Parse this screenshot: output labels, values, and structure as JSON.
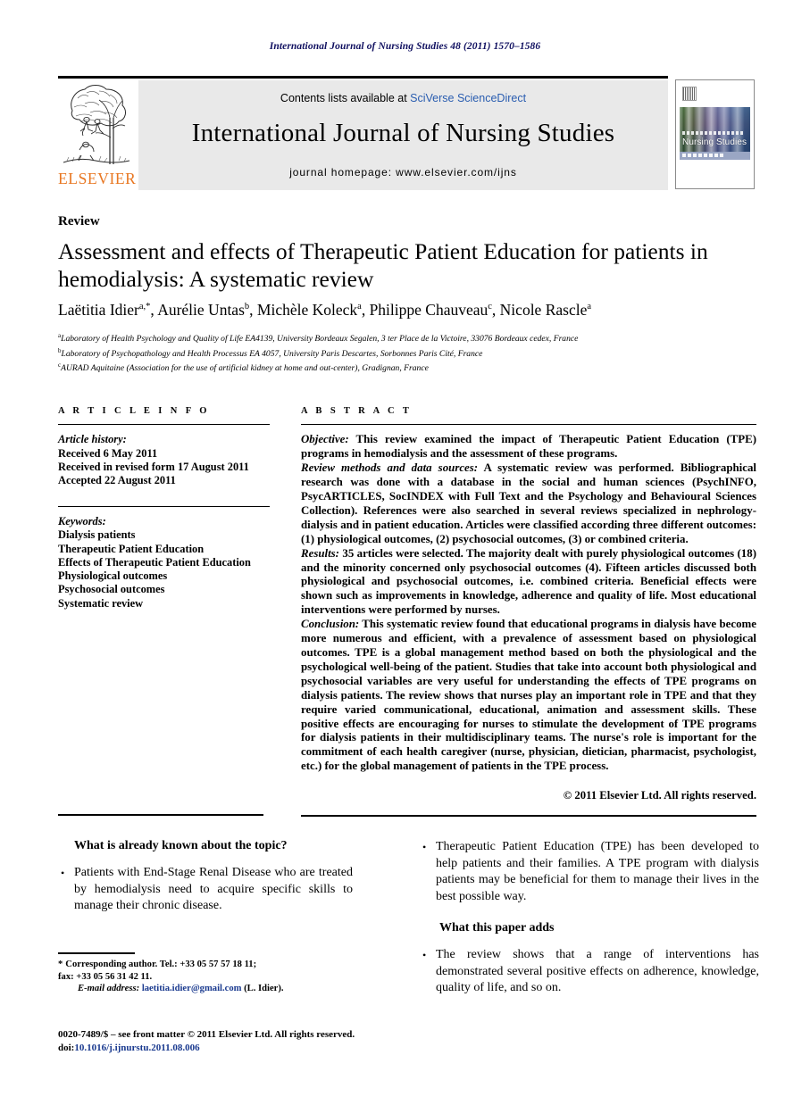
{
  "running_head": "International Journal of Nursing Studies 48 (2011) 1570–1586",
  "masthead": {
    "contents_prefix": "Contents lists available at ",
    "contents_link": "SciVerse ScienceDirect",
    "journal_name": "International Journal of Nursing Studies",
    "homepage": "journal homepage: www.elsevier.com/ijns",
    "publisher_wordmark": "ELSEVIER",
    "cover_title": "Nursing Studies",
    "accent_orange": "#E87722",
    "accent_link_blue": "#2a5db0"
  },
  "article": {
    "section": "Review",
    "title": "Assessment and effects of Therapeutic Patient Education for patients in hemodialysis: A systematic review",
    "authors": [
      {
        "name": "Laëtitia Idier",
        "marks": "a,*"
      },
      {
        "name": "Aurélie Untas",
        "marks": "b"
      },
      {
        "name": "Michèle Koleck",
        "marks": "a"
      },
      {
        "name": "Philippe Chauveau",
        "marks": "c"
      },
      {
        "name": "Nicole Rascle",
        "marks": "a"
      }
    ],
    "affiliations": [
      {
        "mark": "a",
        "text": "Laboratory of Health Psychology and Quality of Life EA4139, University Bordeaux Segalen, 3 ter Place de la Victoire, 33076 Bordeaux cedex, France"
      },
      {
        "mark": "b",
        "text": "Laboratory of Psychopathology and Health Processus EA 4057, University Paris Descartes, Sorbonnes Paris Cité, France"
      },
      {
        "mark": "c",
        "text": "AURAD Aquitaine (Association for the use of artificial kidney at home and out-center), Gradignan, France"
      }
    ]
  },
  "article_info": {
    "label": "A R T I C L E  I N F O",
    "history_title": "Article history:",
    "history": [
      "Received 6 May 2011",
      "Received in revised form 17 August 2011",
      "Accepted 22 August 2011"
    ],
    "keywords_title": "Keywords:",
    "keywords": [
      "Dialysis patients",
      "Therapeutic Patient Education",
      "Effects of Therapeutic Patient Education",
      "Physiological outcomes",
      "Psychosocial outcomes",
      "Systematic review"
    ]
  },
  "abstract": {
    "label": "A B S T R A C T",
    "sections": [
      {
        "lead": "Objective:",
        "body": " This review examined the impact of Therapeutic Patient Education (TPE) programs in hemodialysis and the assessment of these programs."
      },
      {
        "lead": "Review methods and data sources:",
        "body": " A systematic review was performed. Bibliographical research was done with a database in the social and human sciences (PsychINFO, PsycARTICLES, SocINDEX with Full Text and the Psychology and Behavioural Sciences Collection). References were also searched in several reviews specialized in nephrology-dialysis and in patient education. Articles were classified according three different outcomes: (1) physiological outcomes, (2) psychosocial outcomes, (3) or combined criteria."
      },
      {
        "lead": "Results:",
        "body": " 35 articles were selected. The majority dealt with purely physiological outcomes (18) and the minority concerned only psychosocial outcomes (4). Fifteen articles discussed both physiological and psychosocial outcomes, i.e. combined criteria. Beneficial effects were shown such as improvements in knowledge, adherence and quality of life. Most educational interventions were performed by nurses."
      },
      {
        "lead": "Conclusion:",
        "body": " This systematic review found that educational programs in dialysis have become more numerous and efficient, with a prevalence of assessment based on physiological outcomes. TPE is a global management method based on both the physiological and the psychological well-being of the patient. Studies that take into account both physiological and psychosocial variables are very useful for understanding the effects of TPE programs on dialysis patients. The review shows that nurses play an important role in TPE and that they require varied communicational, educational, animation and assessment skills. These positive effects are encouraging for nurses to stimulate the development of TPE programs for dialysis patients in their multidisciplinary teams. The nurse's role is important for the commitment of each health caregiver (nurse, physician, dietician, pharmacist, psychologist, etc.) for the global management of patients in the TPE process."
      }
    ],
    "copyright": "© 2011 Elsevier Ltd. All rights reserved."
  },
  "highlights": {
    "known_heading": "What is already known about the topic?",
    "known_items": [
      "Patients with End-Stage Renal Disease who are treated by hemodialysis need to acquire specific skills to manage their chronic disease.",
      "Therapeutic Patient Education (TPE) has been developed to help patients and their families. A TPE program with dialysis patients may be beneficial for them to manage their lives in the best possible way."
    ],
    "adds_heading": "What this paper adds",
    "adds_items": [
      "The review shows that a range of interventions has demonstrated several positive effects on adherence, knowledge, quality of life, and so on."
    ]
  },
  "footnotes": {
    "corresponding": "Corresponding author. Tel.: +33 05 57 57 18 11;",
    "fax": "fax: +33 05 56 31 42 11.",
    "email_label": "E-mail address:",
    "email": "laetitia.idier@gmail.com",
    "email_suffix": " (L. Idier).",
    "issn_line": "0020-7489/$ – see front matter © 2011 Elsevier Ltd. All rights reserved.",
    "doi_label": "doi:",
    "doi": "10.1016/j.ijnurstu.2011.08.006"
  }
}
